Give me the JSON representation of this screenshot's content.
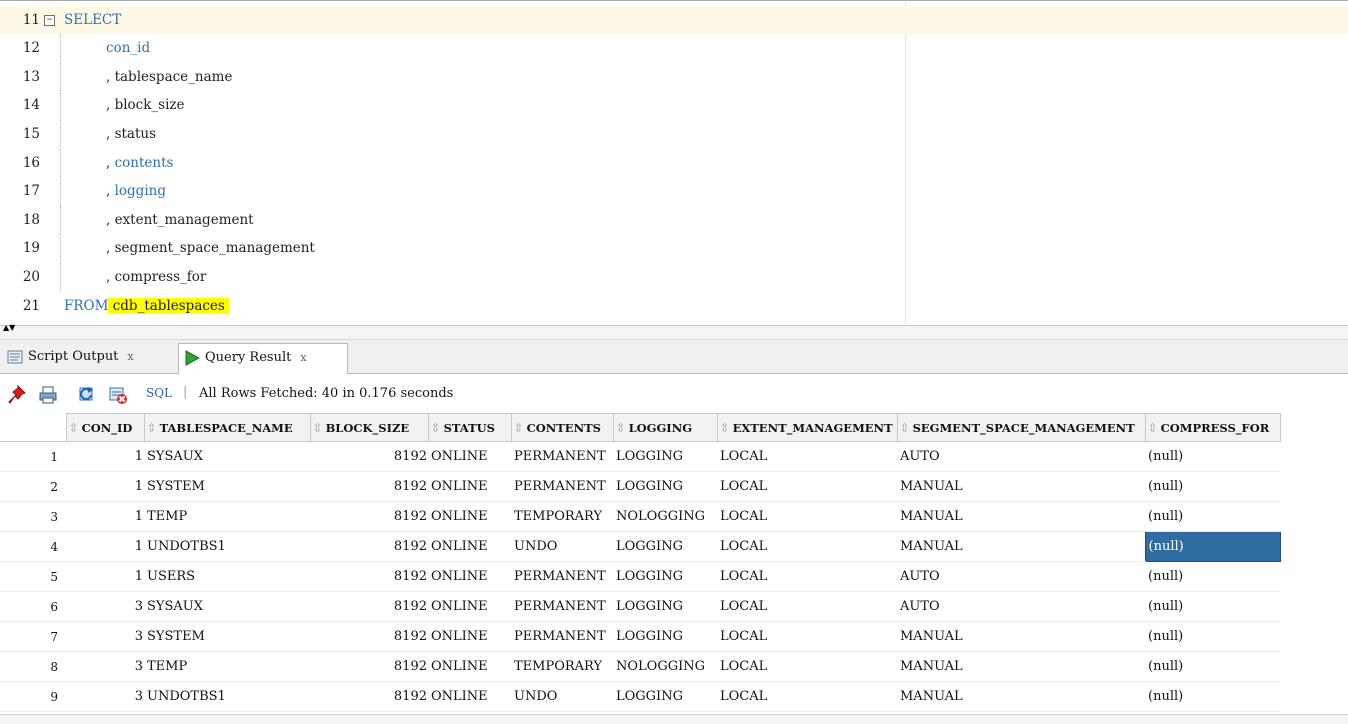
{
  "editor": {
    "lines": [
      {
        "num": "11",
        "fold": "−",
        "segments": [
          {
            "text": "SELECT",
            "cls": "kw"
          }
        ],
        "indent": 0,
        "current": true
      },
      {
        "num": "12",
        "segments": [
          {
            "text": "con_id",
            "cls": "kw"
          }
        ],
        "indent": 1
      },
      {
        "num": "13",
        "segments": [
          {
            "text": ", tablespace_name",
            "cls": ""
          }
        ],
        "indent": 1
      },
      {
        "num": "14",
        "segments": [
          {
            "text": ", block_size",
            "cls": ""
          }
        ],
        "indent": 1
      },
      {
        "num": "15",
        "segments": [
          {
            "text": ", status",
            "cls": ""
          }
        ],
        "indent": 1
      },
      {
        "num": "16",
        "segments": [
          {
            "text": ", ",
            "cls": ""
          },
          {
            "text": "contents",
            "cls": "kw"
          }
        ],
        "indent": 1
      },
      {
        "num": "17",
        "segments": [
          {
            "text": ", ",
            "cls": ""
          },
          {
            "text": "logging",
            "cls": "kw"
          }
        ],
        "indent": 1
      },
      {
        "num": "18",
        "segments": [
          {
            "text": ", extent_management",
            "cls": ""
          }
        ],
        "indent": 1
      },
      {
        "num": "19",
        "segments": [
          {
            "text": ", segment_space_management",
            "cls": ""
          }
        ],
        "indent": 1
      },
      {
        "num": "20",
        "segments": [
          {
            "text": ", compress_for",
            "cls": ""
          }
        ],
        "indent": 1
      },
      {
        "num": "21",
        "segments": [
          {
            "text": "FROM",
            "cls": "kw"
          },
          {
            "text": " cdb_tablespaces ",
            "cls": "hl"
          }
        ],
        "indent": 0
      }
    ]
  },
  "tabs": [
    {
      "label": "Script Output",
      "close": "x",
      "icon": "script-output-icon"
    },
    {
      "label": "Query Result",
      "close": "x",
      "icon": "run-query-icon",
      "active": true
    }
  ],
  "toolbar": {
    "sql_label": "SQL",
    "separator": "|",
    "status": "All Rows Fetched: 40 in 0.176 seconds"
  },
  "grid": {
    "columns": [
      "CON_ID",
      "TABLESPACE_NAME",
      "BLOCK_SIZE",
      "STATUS",
      "CONTENTS",
      "LOGGING",
      "EXTENT_MANAGEMENT",
      "SEGMENT_SPACE_MANAGEMENT",
      "COMPRESS_FOR"
    ],
    "rows": [
      [
        "1",
        "1",
        "SYSAUX",
        "8192",
        "ONLINE",
        "PERMANENT",
        "LOGGING",
        "LOCAL",
        "AUTO",
        "(null)"
      ],
      [
        "2",
        "1",
        "SYSTEM",
        "8192",
        "ONLINE",
        "PERMANENT",
        "LOGGING",
        "LOCAL",
        "MANUAL",
        "(null)"
      ],
      [
        "3",
        "1",
        "TEMP",
        "8192",
        "ONLINE",
        "TEMPORARY",
        "NOLOGGING",
        "LOCAL",
        "MANUAL",
        "(null)"
      ],
      [
        "4",
        "1",
        "UNDOTBS1",
        "8192",
        "ONLINE",
        "UNDO",
        "LOGGING",
        "LOCAL",
        "MANUAL",
        "(null)"
      ],
      [
        "5",
        "1",
        "USERS",
        "8192",
        "ONLINE",
        "PERMANENT",
        "LOGGING",
        "LOCAL",
        "AUTO",
        "(null)"
      ],
      [
        "6",
        "3",
        "SYSAUX",
        "8192",
        "ONLINE",
        "PERMANENT",
        "LOGGING",
        "LOCAL",
        "AUTO",
        "(null)"
      ],
      [
        "7",
        "3",
        "SYSTEM",
        "8192",
        "ONLINE",
        "PERMANENT",
        "LOGGING",
        "LOCAL",
        "MANUAL",
        "(null)"
      ],
      [
        "8",
        "3",
        "TEMP",
        "8192",
        "ONLINE",
        "TEMPORARY",
        "NOLOGGING",
        "LOCAL",
        "MANUAL",
        "(null)"
      ],
      [
        "9",
        "3",
        "UNDOTBS1",
        "8192",
        "ONLINE",
        "UNDO",
        "LOGGING",
        "LOCAL",
        "MANUAL",
        "(null)"
      ]
    ],
    "selected": {
      "row": 3,
      "col": 9
    },
    "sort_icon": "⇳"
  }
}
